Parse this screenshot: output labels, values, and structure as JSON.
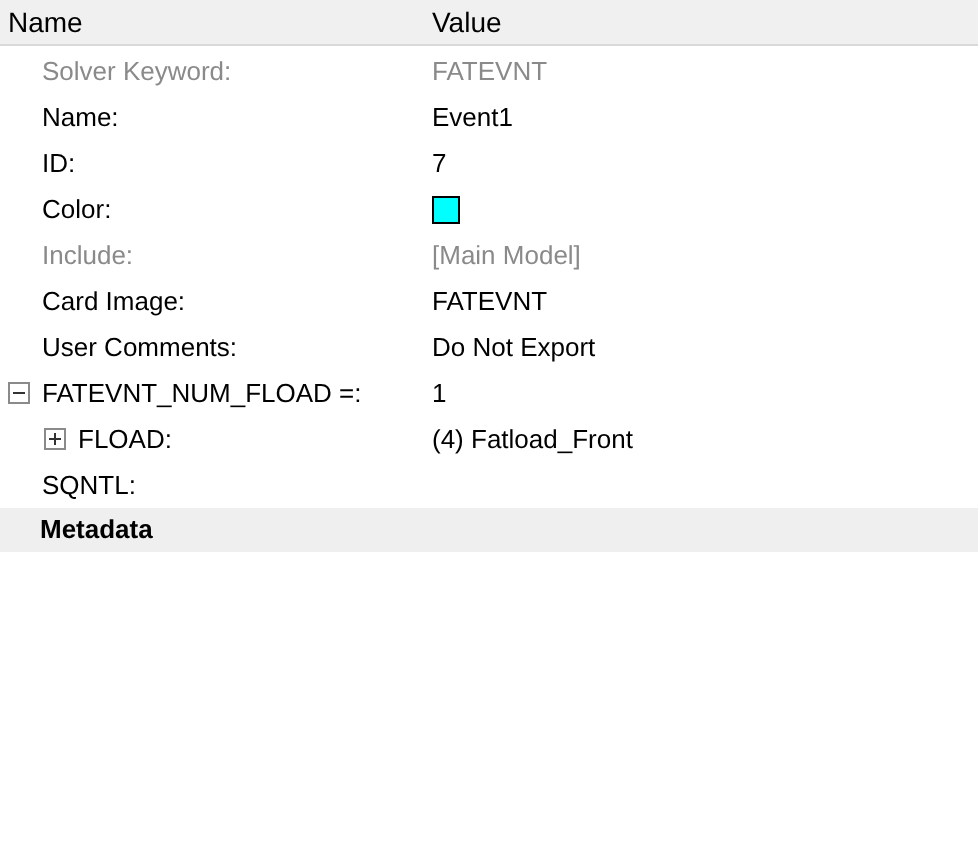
{
  "columns": [
    "Name",
    "Value"
  ],
  "rows": [
    {
      "name": "Solver Keyword:",
      "value": "FATEVNT",
      "disabled": true,
      "kind": "text"
    },
    {
      "name": "Name:",
      "value": "Event1",
      "disabled": false,
      "kind": "text"
    },
    {
      "name": "ID:",
      "value": "7",
      "disabled": false,
      "kind": "text"
    },
    {
      "name": "Color:",
      "color": "#00ffff",
      "disabled": false,
      "kind": "color"
    },
    {
      "name": "Include:",
      "value": "[Main Model]",
      "disabled": true,
      "kind": "text"
    },
    {
      "name": "Card Image:",
      "value": "FATEVNT",
      "disabled": false,
      "kind": "text"
    },
    {
      "name": "User Comments:",
      "value": "Do Not Export",
      "disabled": false,
      "kind": "text"
    },
    {
      "name": "FATEVNT_NUM_FLOAD =:",
      "value": "1",
      "disabled": false,
      "kind": "text",
      "expanded": true,
      "children": [
        {
          "name": "FLOAD:",
          "value": "(4) Fatload_Front",
          "disabled": false,
          "kind": "text",
          "expanded": false
        }
      ]
    },
    {
      "name": "SQNTL:",
      "disabled": false,
      "kind": "text"
    }
  ],
  "sections": [
    {
      "title": "Metadata"
    }
  ]
}
